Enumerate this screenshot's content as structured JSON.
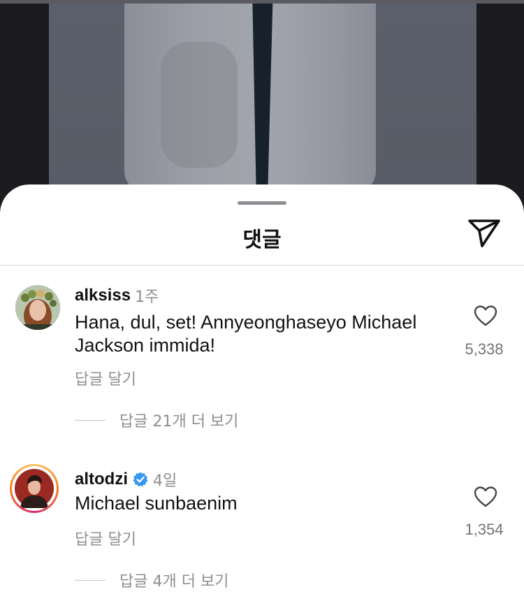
{
  "sheet": {
    "title": "댓글",
    "send_icon": "send-paper-plane-icon"
  },
  "comments": [
    {
      "username": "alksiss",
      "verified": false,
      "time": "1주",
      "text": "Hana, dul, set! Annyeonghaseyo Michael Jackson immida!",
      "reply_label": "답글 달기",
      "view_replies_label": "답글 21개 더 보기",
      "likes": "5,338",
      "heart_icon": "heart-outline-icon"
    },
    {
      "username": "altodzi",
      "verified": true,
      "time": "4일",
      "text": "Michael sunbaenim",
      "reply_label": "답글 달기",
      "view_replies_label": "답글 4개 더 보기",
      "likes": "1,354",
      "heart_icon": "heart-outline-icon"
    }
  ],
  "colors": {
    "sheet_bg": "#ffffff",
    "secondary_text": "#8e8e8e",
    "verified_blue": "#3897f0",
    "story_ring_start": "#fdc468",
    "story_ring_end": "#d62976"
  }
}
